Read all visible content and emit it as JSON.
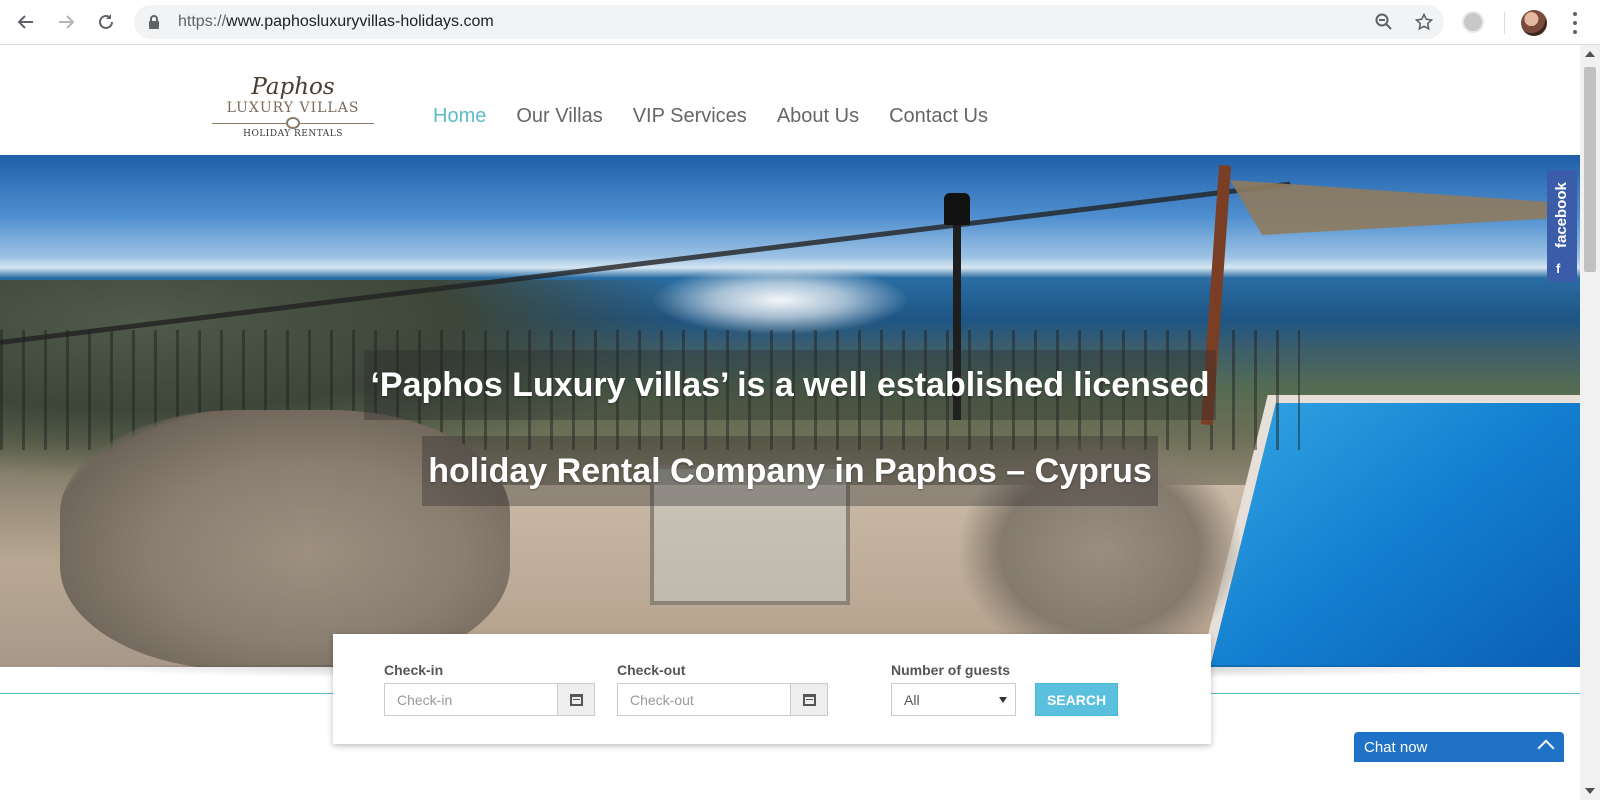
{
  "browser": {
    "url_scheme": "https://",
    "url_host": "www.paphosluxuryvillas-holidays.com"
  },
  "site": {
    "logo": {
      "script": "Paphos",
      "main": "LUXURY VILLAS",
      "sub": "HOLIDAY RENTALS"
    },
    "nav": [
      {
        "label": "Home",
        "active": true
      },
      {
        "label": "Our Villas",
        "active": false
      },
      {
        "label": "VIP Services",
        "active": false
      },
      {
        "label": "About Us",
        "active": false
      },
      {
        "label": "Contact Us",
        "active": false
      }
    ],
    "accent_color": "#5bbcc5"
  },
  "hero": {
    "line1": "‘Paphos Luxury villas’ is a well established licensed",
    "line2": "holiday Rental Company in Paphos – Cyprus"
  },
  "facebook_tab": {
    "label": "facebook",
    "icon_letter": "f",
    "color": "#3b5ca8"
  },
  "booking": {
    "checkin_label": "Check-in",
    "checkin_placeholder": "Check-in",
    "checkout_label": "Check-out",
    "checkout_placeholder": "Check-out",
    "guests_label": "Number of guests",
    "guests_value": "All",
    "search_label": "SEARCH",
    "search_color": "#5bc0de"
  },
  "chat": {
    "label": "Chat now",
    "color": "#1f72c6"
  }
}
